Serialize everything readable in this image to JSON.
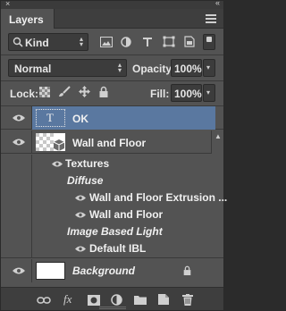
{
  "panel": {
    "tab_title": "Layers",
    "close_glyph": "×",
    "collapse_glyph": "«"
  },
  "filter": {
    "kind_label": "Kind"
  },
  "blend": {
    "mode": "Normal",
    "opacity_label": "Opacity:",
    "opacity_value": "100%"
  },
  "lock": {
    "label": "Lock:",
    "fill_label": "Fill:",
    "fill_value": "100%"
  },
  "layers": [
    {
      "name": "OK",
      "type": "text",
      "thumb_glyph": "T"
    },
    {
      "name": "Wall and Floor",
      "type": "3d"
    },
    {
      "name": "Textures",
      "type": "group"
    },
    {
      "name": "Diffuse",
      "type": "subheader"
    },
    {
      "name": "Wall and Floor Extrusion ...",
      "type": "sub-item"
    },
    {
      "name": "Wall and Floor",
      "type": "sub-item"
    },
    {
      "name": "Image Based Light",
      "type": "subheader"
    },
    {
      "name": "Default IBL",
      "type": "sub-item"
    },
    {
      "name": "Background",
      "type": "background"
    }
  ],
  "bottom_icons": [
    "link-icon",
    "fx-icon",
    "mask-icon",
    "adjustment-icon",
    "folder-icon",
    "new-layer-icon",
    "trash-icon"
  ],
  "fx_label": "fx",
  "colors": {
    "panel_bg": "#535353",
    "selected_row": "#5a78a0",
    "field_bg": "#3c3c3c"
  }
}
